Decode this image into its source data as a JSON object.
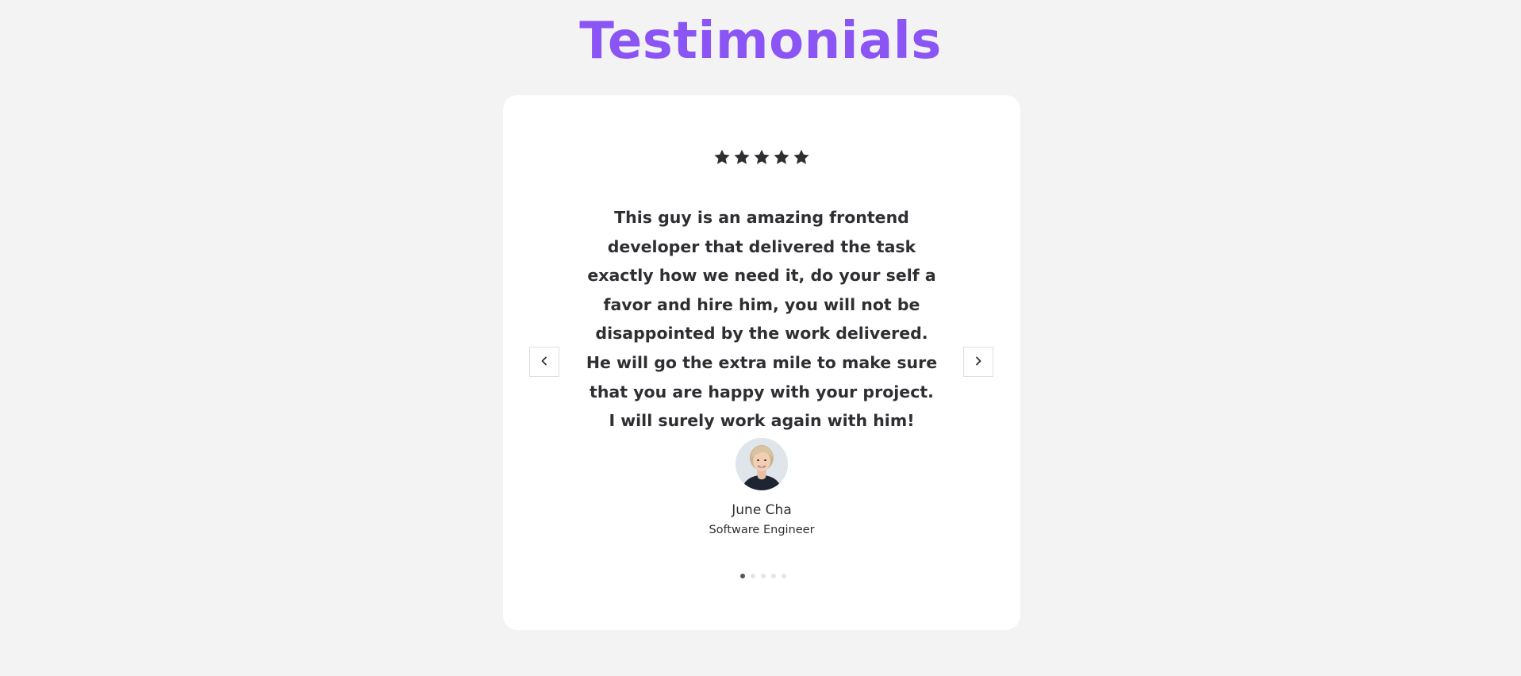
{
  "page": {
    "title": "Testimonials",
    "colors": {
      "title": "#8b55f6",
      "text": "#2f2f33",
      "background": "#f3f3f3",
      "card": "#ffffff",
      "dot_active": "#555555",
      "dot_inactive": "#e4e4e4"
    }
  },
  "testimonial": {
    "rating": 5,
    "rating_max": 5,
    "quote": "This guy is an amazing frontend developer that delivered the task exactly how we need it, do your self a favor and hire him, you will not be disappointed by the work delivered. He will go the extra mile to make sure that you are happy with your project. I will surely work again with him!",
    "author_name": "June Cha",
    "author_role": "Software Engineer",
    "avatar_icon": "person-photo"
  },
  "carousel": {
    "prev_icon": "chevron-left-icon",
    "next_icon": "chevron-right-icon",
    "total_slides": 5,
    "active_index": 0
  }
}
